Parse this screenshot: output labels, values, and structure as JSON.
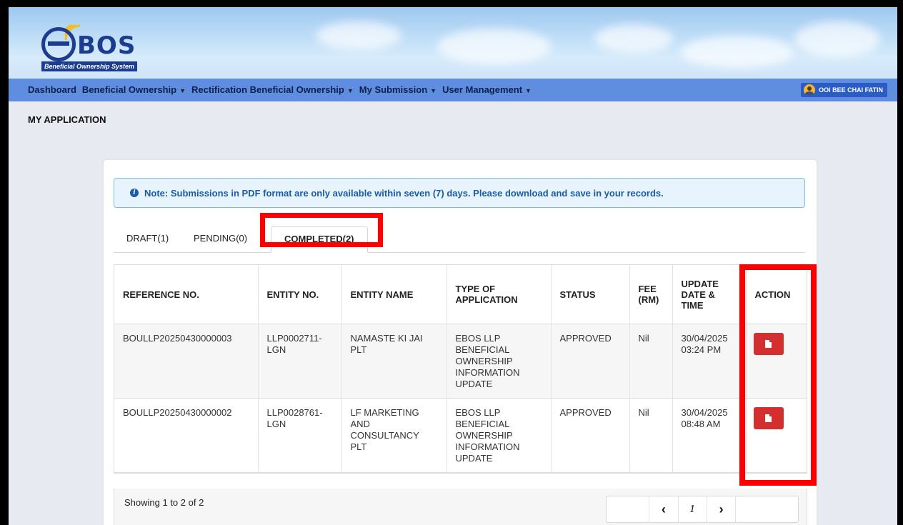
{
  "app": {
    "logo_text": "BOS",
    "logo_subtitle": "Beneficial Ownership System"
  },
  "nav": {
    "items": [
      {
        "label": "Dashboard",
        "has_dropdown": false
      },
      {
        "label": "Beneficial Ownership",
        "has_dropdown": true
      },
      {
        "label": "Rectification Beneficial Ownership",
        "has_dropdown": true
      },
      {
        "label": "My Submission",
        "has_dropdown": true
      },
      {
        "label": "User Management",
        "has_dropdown": true
      }
    ],
    "user_name": "OOI BEE CHAI FATIN"
  },
  "page": {
    "title": "MY APPLICATION"
  },
  "note": {
    "text": "Note: Submissions in PDF format are only available within seven (7) days. Please download and save in your records."
  },
  "tabs": [
    {
      "label": "DRAFT(1)",
      "active": false
    },
    {
      "label": "PENDING(0)",
      "active": false
    },
    {
      "label": "COMPLETED(2)",
      "active": true
    }
  ],
  "table": {
    "headers": [
      "REFERENCE NO.",
      "ENTITY NO.",
      "ENTITY NAME",
      "TYPE OF APPLICATION",
      "STATUS",
      "FEE (RM)",
      "UPDATE DATE & TIME",
      "ACTION"
    ],
    "rows": [
      {
        "reference": "BOULLP20250430000003",
        "entity_no": "LLP0002711-LGN",
        "entity_name": "NAMASTE KI JAI PLT",
        "type": "EBOS LLP BENEFICIAL OWNERSHIP INFORMATION UPDATE",
        "status": "APPROVED",
        "fee": "Nil",
        "updated": "30/04/2025 03:24 PM"
      },
      {
        "reference": "BOULLP20250430000002",
        "entity_no": "LLP0028761-LGN",
        "entity_name": "LF MARKETING AND CONSULTANCY PLT",
        "type": "EBOS LLP BENEFICIAL OWNERSHIP INFORMATION UPDATE",
        "status": "APPROVED",
        "fee": "Nil",
        "updated": "30/04/2025 08:48 AM"
      }
    ]
  },
  "footer": {
    "showing": "Showing 1 to 2 of 2",
    "prev": "‹",
    "current_page": "1",
    "next": "›"
  },
  "colors": {
    "nav_bg": "#5f8ee0",
    "highlight": "#ff0000",
    "pdf_button": "#d32f2f",
    "note_text": "#1a5aa8"
  }
}
